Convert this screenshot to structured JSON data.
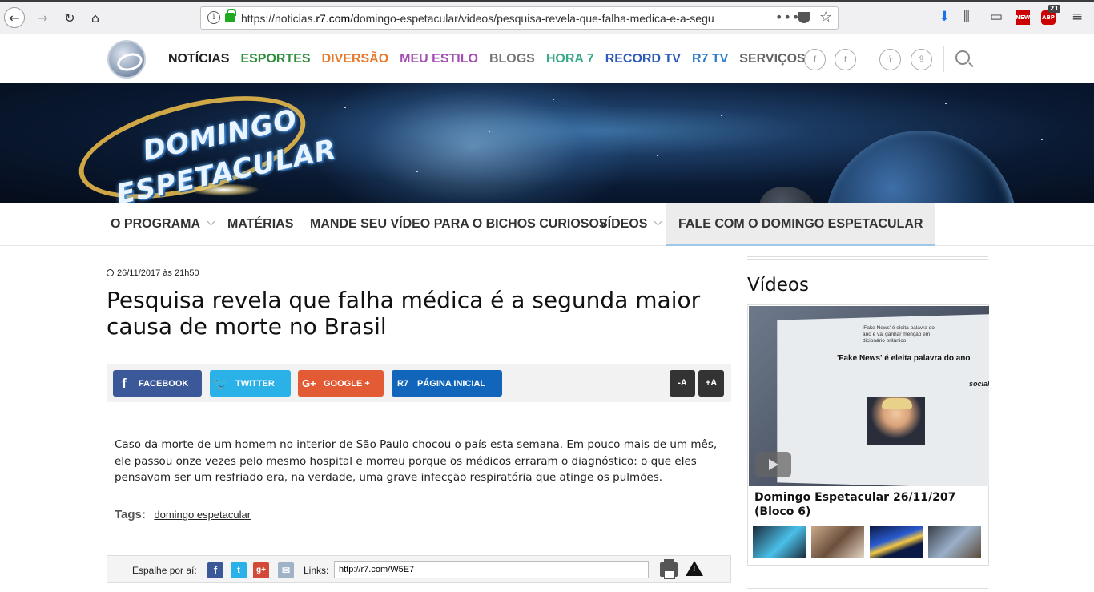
{
  "browser": {
    "url_prefix": "https://noticias.",
    "url_domain": "r7.com",
    "url_path": "/domingo-espetacular/videos/pesquisa-revela-que-falha-medica-e-a-segu",
    "more_label": "•••",
    "abp_label": "ABP",
    "abp_count": "21",
    "new_label": "NEW"
  },
  "site": {
    "nav": [
      {
        "label": "NOTÍCIAS",
        "color": "#222222"
      },
      {
        "label": "ESPORTES",
        "color": "#2d8f3c"
      },
      {
        "label": "DIVERSÃO",
        "color": "#e8782a"
      },
      {
        "label": "MEU ESTILO",
        "color": "#a34fb2"
      },
      {
        "label": "BLOGS",
        "color": "#777777"
      },
      {
        "label": "HORA 7",
        "color": "#3aa88a"
      },
      {
        "label": "RECORD TV",
        "color": "#2d5bb8"
      },
      {
        "label": "R7 TV",
        "color": "#2a7bc8"
      },
      {
        "label": "SERVIÇOS",
        "color": "#666666"
      }
    ],
    "social": [
      "f",
      "t"
    ],
    "banner_logo_line1": "DOMINGO",
    "banner_logo_line2": "ESPETACULAR"
  },
  "subnav": [
    {
      "label": "O PROGRAMA",
      "has_caret": true
    },
    {
      "label": "MATÉRIAS",
      "has_caret": false
    },
    {
      "label": "MANDE SEU VÍDEO PARA O BICHOS CURIOSOS",
      "has_caret": false
    },
    {
      "label": "VÍDEOS",
      "has_caret": true
    },
    {
      "label": "FALE COM O DOMINGO ESPETACULAR",
      "has_caret": false,
      "active": true
    }
  ],
  "article": {
    "date": "26/11/2017 às 21h50",
    "title": "Pesquisa revela que falha médica é a segunda maior causa de morte no Brasil",
    "share": {
      "facebook": "FACEBOOK",
      "twitter": "TWITTER",
      "google": "GOOGLE +",
      "home": "PÁGINA INICIAL",
      "font_minus": "-A",
      "font_plus": "+A"
    },
    "body": "Caso da morte de um homem no interior de São Paulo chocou o país esta semana. Em pouco mais de um mês, ele passou onze vezes pelo mesmo hospital e morreu porque os médicos erraram o diagnóstico: o que eles pensavam ser um resfriado era, na verdade, uma grave infecção respiratória que atinge os pulmões.",
    "tags_label": "Tags:",
    "tags": [
      "domingo espetacular"
    ],
    "spread_label": "Espalhe por aí:",
    "links_label": "Links:",
    "short_link": "http://r7.com/W5E7"
  },
  "sidebar": {
    "title": "Vídeos",
    "featured_caption": "Domingo Espetacular 26/11/207 (Bloco 6)",
    "thumb_headline": "'Fake News' é eleita palavra do ano e vai ganhar menção em dicionário britânico",
    "thumb_headline_big": "'Fake News' é eleita palavra do ano",
    "thumb_social": "social"
  }
}
